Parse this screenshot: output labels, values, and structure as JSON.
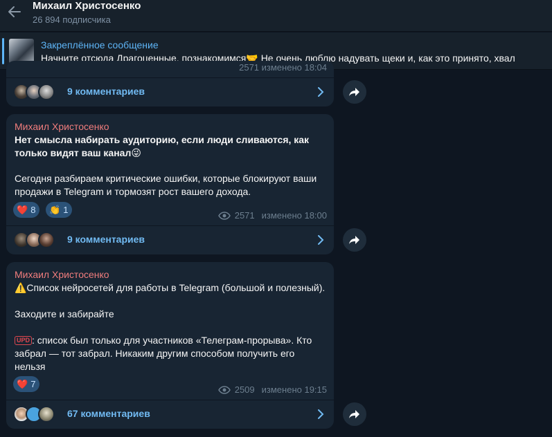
{
  "header": {
    "channel_name": "Михаил Христосенко",
    "subscribers": "26 894 подписчика"
  },
  "pinned": {
    "title": "Закреплённое сообщение",
    "text": "Начните отсюда  Драгоценные, познакомимся🤝  Не очень люблю надувать щеки и, как это принято, хвал"
  },
  "messages": [
    {
      "partial_meta": "2571  изменено 18:04",
      "comments": "9 комментариев"
    },
    {
      "sender": "Михаил Христосенко",
      "title": "Нет смысла набирать аудиторию, если люди сливаются, как только видят ваш канал😜",
      "body": "Сегодня разбираем критические ошибки, которые блокируют ваши продажи в Telegram и тормозят рост вашего дохода.",
      "reactions": [
        {
          "emoji": "❤️",
          "count": "8"
        },
        {
          "emoji": "👏",
          "count": "1"
        }
      ],
      "views": "2571",
      "edited": "изменено 18:00",
      "comments": "9 комментариев"
    },
    {
      "sender": "Михаил Христосенко",
      "line1": "⚠️Список нейросетей для работы в Telegram (большой и полезный).",
      "line2": "Заходите и забирайте",
      "upd_badge": "UPD",
      "line3": ": список был только для участников «Телеграм-прорыва». Кто забрал — тот забрал. Никаким другим способом получить его нельзя",
      "reactions": [
        {
          "emoji": "❤️",
          "count": "7"
        }
      ],
      "views": "2509",
      "edited": "изменено 19:15",
      "comments": "67 комментариев"
    }
  ],
  "colors": {
    "background": "#0e1621",
    "bubble": "#182533",
    "accent": "#5eb5f7",
    "sender": "#f17d7d",
    "reaction_bg": "#2b5278"
  }
}
